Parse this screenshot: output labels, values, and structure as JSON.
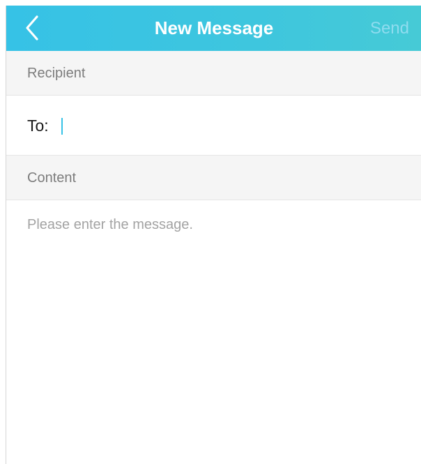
{
  "header": {
    "title": "New Message",
    "send_label": "Send",
    "back_icon": "chevron-left-icon"
  },
  "recipient": {
    "section_label": "Recipient",
    "to_label": "To:",
    "to_value": ""
  },
  "content": {
    "section_label": "Content",
    "placeholder": "Please enter the message.",
    "value": ""
  },
  "colors": {
    "header_gradient_start": "#36c2e6",
    "header_gradient_end": "#46cad6",
    "send_disabled": "#8fdcef",
    "caret": "#36c2e6",
    "section_bg": "#f5f5f5"
  }
}
